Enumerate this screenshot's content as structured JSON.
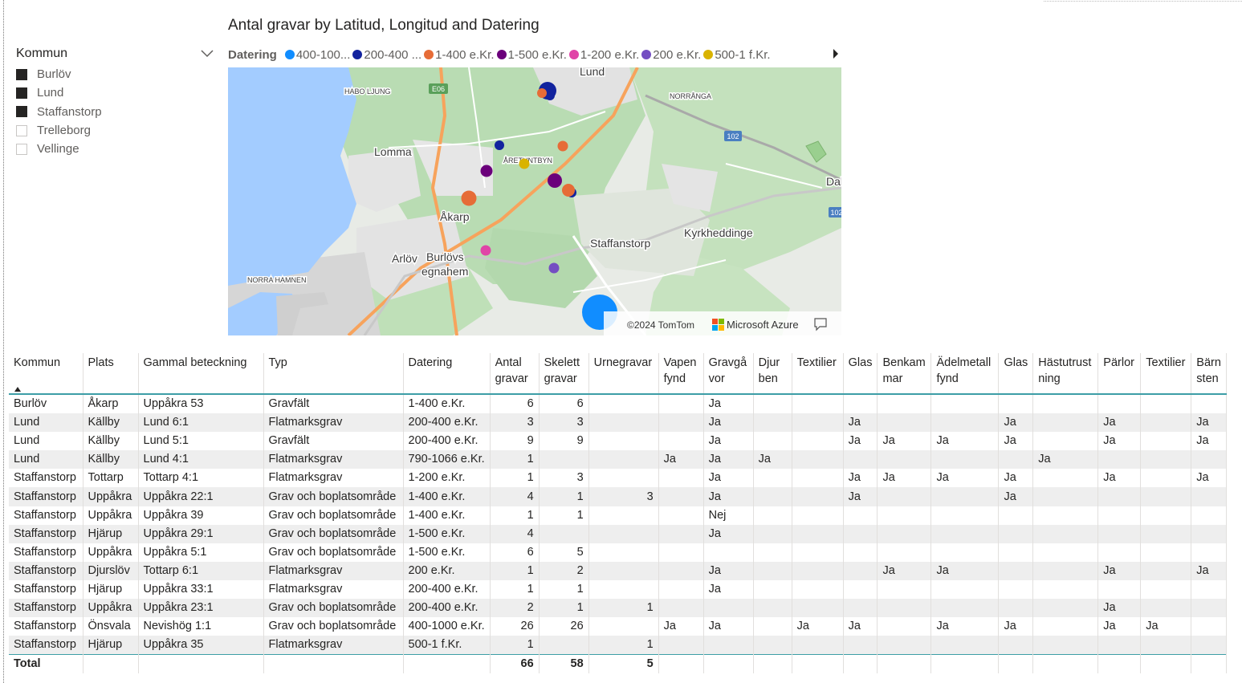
{
  "slicer": {
    "title": "Kommun",
    "items": [
      {
        "label": "Burlöv",
        "checked": true
      },
      {
        "label": "Lund",
        "checked": true
      },
      {
        "label": "Staffanstorp",
        "checked": true
      },
      {
        "label": "Trelleborg",
        "checked": false
      },
      {
        "label": "Vellinge",
        "checked": false
      }
    ]
  },
  "map": {
    "title": "Antal gravar by Latitud, Longitud and Datering",
    "legend_title": "Datering",
    "legend": [
      {
        "label": "400-100...",
        "color": "#118dff"
      },
      {
        "label": "200-400 ...",
        "color": "#12239e"
      },
      {
        "label": "1-400 e.Kr.",
        "color": "#e66c37"
      },
      {
        "label": "1-500 e.Kr.",
        "color": "#6b007b"
      },
      {
        "label": "1-200 e.Kr.",
        "color": "#e044a7"
      },
      {
        "label": "200 e.Kr.",
        "color": "#744ec2"
      },
      {
        "label": "500-1 f.Kr.",
        "color": "#d9b300"
      }
    ],
    "place_labels": {
      "lund": "Lund",
      "habo_ljung": "HABO LJUNG",
      "norranga": "NORRÅNGA",
      "lomma": "Lomma",
      "aretuntbyn": "ÅRETUNTBYN",
      "akarp": "Åkarp",
      "staffanstorp": "Staffanstorp",
      "kyrkheddinge": "Kyrkheddinge",
      "arlov": "Arlöv",
      "burlovs": "Burlövs",
      "egnahem": "egnahem",
      "norra_hamnen": "NORRA HAMNEN",
      "dal": "Dal",
      "e06": "E06",
      "r102a": "102",
      "r102b": "102"
    },
    "attribution_tomtom": "©2024 TomTom",
    "attribution_azure": "Microsoft Azure"
  },
  "table": {
    "columns": [
      "Kommun",
      "Plats",
      "Gammal beteckning",
      "Typ",
      "Datering",
      "Antal gravar",
      "Skelett gravar",
      "Urnegravar",
      "Vapen fynd",
      "Gravgå vor",
      "Djur ben",
      "Textilier",
      "Glas",
      "Benkam mar",
      "Ädelmetall fynd",
      "Glas",
      "Hästutrust ning",
      "Pärlor",
      "Textilier",
      "Bärn sten"
    ],
    "rows": [
      [
        "Burlöv",
        "Åkarp",
        "Uppåkra 53",
        "Gravfält",
        "1-400 e.Kr.",
        "6",
        "6",
        "",
        "",
        "Ja",
        "",
        "",
        "",
        "",
        "",
        "",
        "",
        "",
        "",
        ""
      ],
      [
        "Lund",
        "Källby",
        "Lund 6:1",
        "Flatmarksgrav",
        "200-400 e.Kr.",
        "3",
        "3",
        "",
        "",
        "Ja",
        "",
        "",
        "Ja",
        "",
        "",
        "Ja",
        "",
        "Ja",
        "",
        "Ja"
      ],
      [
        "Lund",
        "Källby",
        "Lund 5:1",
        "Gravfält",
        "200-400 e.Kr.",
        "9",
        "9",
        "",
        "",
        "Ja",
        "",
        "",
        "Ja",
        "Ja",
        "Ja",
        "Ja",
        "",
        "Ja",
        "",
        "Ja"
      ],
      [
        "Lund",
        "Källby",
        "Lund 4:1",
        "Flatmarksgrav",
        "790-1066 e.Kr.",
        "1",
        "",
        "",
        "Ja",
        "Ja",
        "Ja",
        "",
        "",
        "",
        "",
        "",
        "Ja",
        "",
        "",
        ""
      ],
      [
        "Staffanstorp",
        "Tottarp",
        "Tottarp 4:1",
        "Flatmarksgrav",
        "1-200 e.Kr.",
        "1",
        "3",
        "",
        "",
        "Ja",
        "",
        "",
        "Ja",
        "Ja",
        "Ja",
        "Ja",
        "",
        "Ja",
        "",
        "Ja"
      ],
      [
        "Staffanstorp",
        "Uppåkra",
        "Uppåkra 22:1",
        "Grav och boplatsområde",
        "1-400 e.Kr.",
        "4",
        "1",
        "3",
        "",
        "Ja",
        "",
        "",
        "Ja",
        "",
        "",
        "Ja",
        "",
        "",
        "",
        ""
      ],
      [
        "Staffanstorp",
        "Uppåkra",
        "Uppåkra 39",
        "Grav och boplatsområde",
        "1-400 e.Kr.",
        "1",
        "1",
        "",
        "",
        "Nej",
        "",
        "",
        "",
        "",
        "",
        "",
        "",
        "",
        "",
        ""
      ],
      [
        "Staffanstorp",
        "Hjärup",
        "Uppåkra 29:1",
        "Grav och boplatsområde",
        "1-500 e.Kr.",
        "4",
        "",
        "",
        "",
        "Ja",
        "",
        "",
        "",
        "",
        "",
        "",
        "",
        "",
        "",
        ""
      ],
      [
        "Staffanstorp",
        "Uppåkra",
        "Uppåkra 5:1",
        "Grav och boplatsområde",
        "1-500 e.Kr.",
        "6",
        "5",
        "",
        "",
        "",
        "",
        "",
        "",
        "",
        "",
        "",
        "",
        "",
        "",
        ""
      ],
      [
        "Staffanstorp",
        "Djurslöv",
        "Tottarp 6:1",
        "Flatmarksgrav",
        "200 e.Kr.",
        "1",
        "2",
        "",
        "",
        "Ja",
        "",
        "",
        "",
        "Ja",
        "Ja",
        "",
        "",
        "Ja",
        "",
        "Ja"
      ],
      [
        "Staffanstorp",
        "Hjärup",
        "Uppåkra 33:1",
        "Flatmarksgrav",
        "200-400 e.Kr.",
        "1",
        "1",
        "",
        "",
        "Ja",
        "",
        "",
        "",
        "",
        "",
        "",
        "",
        "",
        "",
        ""
      ],
      [
        "Staffanstorp",
        "Uppåkra",
        "Uppåkra 23:1",
        "Grav och boplatsområde",
        "200-400 e.Kr.",
        "2",
        "1",
        "1",
        "",
        "",
        "",
        "",
        "",
        "",
        "",
        "",
        "",
        "Ja",
        "",
        ""
      ],
      [
        "Staffanstorp",
        "Önsvala",
        "Nevishög 1:1",
        "Grav och boplatsområde",
        "400-1000 e.Kr.",
        "26",
        "26",
        "",
        "Ja",
        "Ja",
        "",
        "Ja",
        "Ja",
        "",
        "Ja",
        "Ja",
        "",
        "Ja",
        "Ja",
        ""
      ],
      [
        "Staffanstorp",
        "Hjärup",
        "Uppåkra 35",
        "Flatmarksgrav",
        "500-1 f.Kr.",
        "1",
        "",
        "1",
        "",
        "",
        "",
        "",
        "",
        "",
        "",
        "",
        "",
        "",
        "",
        ""
      ]
    ],
    "total": [
      "Total",
      "",
      "",
      "",
      "",
      "66",
      "58",
      "5",
      "",
      "",
      "",
      "",
      "",
      "",
      "",
      "",
      "",
      "",
      "",
      ""
    ]
  }
}
